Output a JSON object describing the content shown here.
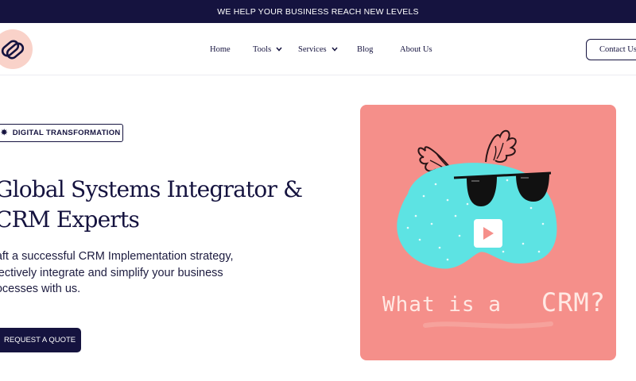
{
  "announcement": "WE HELP YOUR BUSINESS REACH NEW LEVELS",
  "logo": {
    "icon": "interlocking-rings-logo-icon",
    "bg_color": "#f9d2c9"
  },
  "nav": {
    "items": [
      {
        "label": "Home"
      },
      {
        "label": "Tools",
        "has_dropdown": true
      },
      {
        "label": "Services",
        "has_dropdown": true
      },
      {
        "label": "Blog"
      },
      {
        "label": "About Us"
      }
    ],
    "contact_label": "Contact Us"
  },
  "hero": {
    "badge_icon": "star-burst-icon",
    "badge": "DIGITAL TRANSFORMATION",
    "title_line1": "Global Systems Integrator &",
    "title_line2": "CRM Experts",
    "desc_line1": "raft a successful CRM Implementation strategy,",
    "desc_line2": "ffectively integrate and simplify your business",
    "desc_line3": "rocesses with us.",
    "cta": "REQUEST A QUOTE"
  },
  "video": {
    "caption_part1": "What is a",
    "caption_part2": "CRM?",
    "play_icon": "play-icon",
    "bg_color": "#f58f8a"
  },
  "colors": {
    "primary": "#15133f",
    "accent_pink": "#f58f8a",
    "blob_teal": "#5de3e3"
  }
}
